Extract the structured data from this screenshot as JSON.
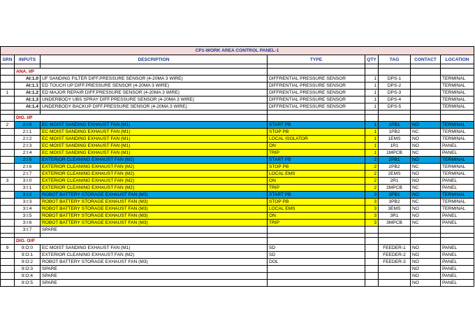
{
  "title": "CP1-WORK AREA CONTROL PANEL-1",
  "headers": [
    "SRN",
    "INPUTS",
    "DESCRIPTION",
    "TYPE",
    "QTY",
    "TAG",
    "CONTACT",
    "LOCATION"
  ],
  "sections": [
    {
      "label": "ANA. I/P",
      "srn": "1",
      "rows": [
        {
          "input": "AI:1.0",
          "desc": "UF SANDING  FILTER DIFF.PRESSURE SENSOR (4-20MA 3 WIRE)",
          "type": "DIFFRENTIAL PRESSURE SENSOR",
          "qty": "1",
          "tag": "DPS-1",
          "contact": "",
          "loc": "TERMINAL"
        },
        {
          "input": "AI:1.1",
          "desc": "ED TOUCH UP DIFF.PRESSURE SENSOR (4-20MA 3 WIRE)",
          "type": "DIFFRENTIAL PRESSURE SENSOR",
          "qty": "1",
          "tag": "DPS-2",
          "contact": "",
          "loc": "TERMINAL"
        },
        {
          "input": "AI:1.2",
          "desc": "ED MAJOR REPAIR DIFF.PRESSURE SENSOR (4-20MA 3 WIRE)",
          "type": "DIFFRENTIAL PRESSURE SENSOR",
          "qty": "1",
          "tag": "DPS-3",
          "contact": "",
          "loc": "TERMINAL"
        },
        {
          "input": "AI:1.3",
          "desc": "UNDERBODY UBS SPRAY DIFF.PRESSURE SENSOR (4-20MA 3 WIRE)",
          "type": "DIFFRENTIAL PRESSURE SENSOR",
          "qty": "1",
          "tag": "DPS-4",
          "contact": "",
          "loc": "TERMINAL"
        },
        {
          "input": "AI:1.4",
          "desc": "UNDERBODY BACKUP DIFF.PRESSURE SENSOR (4-20MA 3 WIRE)",
          "type": "DIFFRENTIAL PRESSURE SENSOR",
          "qty": "1",
          "tag": "DPS-5",
          "contact": "",
          "loc": "TERMINAL"
        }
      ]
    },
    {
      "label": "DIG. I/P",
      "rows": [
        {
          "srn": "2",
          "input": "2:I:0",
          "desc": "EC MOIST SANDING EXHAUST FAN   (M1)",
          "type": "START PB",
          "qty": "1",
          "tag": "1PB1",
          "contact": "NO",
          "loc": "TERMINAL",
          "style": "blue"
        },
        {
          "srn": "",
          "input": "2:I:1",
          "desc": "EC MOIST SANDING EXHAUST FAN   (M1)",
          "type": "STOP PB",
          "qty": "1",
          "tag": "1PB2",
          "contact": "NC",
          "loc": "TERMINAL",
          "style": "yellow"
        },
        {
          "srn": "",
          "input": "2:I:2",
          "desc": "EC MOIST SANDING EXHAUST FAN   (M1)",
          "type": "LOCAL ISOLATOR",
          "qty": "1",
          "tag": "1EMS",
          "contact": "NO",
          "loc": "TERMINAL",
          "style": "yellow"
        },
        {
          "srn": "",
          "input": "2:I:3",
          "desc": "EC MOIST SANDING EXHAUST FAN   (M1)",
          "type": "ON",
          "qty": "1",
          "tag": "1R1",
          "contact": "NO",
          "loc": "PANEL",
          "style": "yellow"
        },
        {
          "srn": "",
          "input": "2:I:4",
          "desc": "EC MOIST SANDING EXHAUST FAN   (M1)",
          "type": "TRIP",
          "qty": "1",
          "tag": "1MPCB",
          "contact": "NC",
          "loc": "PANEL",
          "style": "yellow"
        },
        {
          "srn": "",
          "input": "2:I:5",
          "desc": "EXTERIOR CLEANING EXHAUST FAN  (M2)",
          "type": "START PB",
          "qty": "2",
          "tag": "2PB1",
          "contact": "NO",
          "loc": "TERMINAL",
          "style": "blue"
        },
        {
          "srn": "",
          "input": "2:I:6",
          "desc": "EXTERIOR CLEANING EXHAUST FAN  (M2)",
          "type": "STOP PB",
          "qty": "2",
          "tag": "2PB2",
          "contact": "NC",
          "loc": "TERMINAL",
          "style": "yellow"
        },
        {
          "srn": "",
          "input": "2:I:7",
          "desc": "EXTERIOR CLEANING EXHAUST FAN  (M2)",
          "type": "LOCAL EMS",
          "qty": "2",
          "tag": "2EMS",
          "contact": "NO",
          "loc": "TERMINAL",
          "style": "yellow"
        },
        {
          "srn": "3",
          "input": "3:I:0",
          "desc": "EXTERIOR CLEANING EXHAUST FAN  (M2)",
          "type": "ON",
          "qty": "2",
          "tag": "2R1",
          "contact": "NO",
          "loc": "PANEL",
          "style": "yellow"
        },
        {
          "srn": "",
          "input": "3:I:1",
          "desc": "EXTERIOR CLEANING EXHAUST FAN  (M2)",
          "type": "TRIP",
          "qty": "2",
          "tag": "2MPCB",
          "contact": "NC",
          "loc": "PANEL",
          "style": "yellow"
        },
        {
          "srn": "",
          "input": "3:I:2",
          "desc": "ROBOT BATTERY STORAGE EXHAUST FAN    (M3)",
          "type": "START PB",
          "qty": "3",
          "tag": "3PB1",
          "contact": "NO",
          "loc": "TERMINAL",
          "style": "blue"
        },
        {
          "srn": "",
          "input": "3:I:3",
          "desc": "ROBOT BATTERY STORAGE EXHAUST FAN    (M3)",
          "type": "STOP PB",
          "qty": "3",
          "tag": "3PB2",
          "contact": "NC",
          "loc": "TERMINAL",
          "style": "yellow"
        },
        {
          "srn": "",
          "input": "3:I:4",
          "desc": "ROBOT BATTERY STORAGE EXHAUST FAN    (M3)",
          "type": "LOCAL EMS",
          "qty": "3",
          "tag": "3EMS",
          "contact": "NO",
          "loc": "TERMINAL",
          "style": "yellow"
        },
        {
          "srn": "",
          "input": "3:I:5",
          "desc": "ROBOT BATTERY STORAGE EXHAUST FAN    (M3)",
          "type": "ON",
          "qty": "3",
          "tag": "3R1",
          "contact": "NO",
          "loc": "PANEL",
          "style": "yellow"
        },
        {
          "srn": "",
          "input": "3:I:6",
          "desc": "ROBOT BATTERY STORAGE EXHAUST FAN    (M3)",
          "type": "TRIP",
          "qty": "3",
          "tag": "3MPCB",
          "contact": "NC",
          "loc": "PANEL",
          "style": "yellow"
        },
        {
          "srn": "",
          "input": "3:I:7",
          "desc": "SPARE",
          "type": "",
          "qty": "",
          "tag": "",
          "contact": "",
          "loc": "",
          "style": ""
        }
      ]
    },
    {
      "label": "DIG. O/P",
      "rows": [
        {
          "srn": "9",
          "input": "9:O:0",
          "desc": "EC MOIST SANDING EXHAUST FAN   (M1)",
          "type": "SD",
          "qty": "",
          "tag": "FEEDER-1",
          "contact": "NO",
          "loc": "PANEL",
          "style": ""
        },
        {
          "srn": "",
          "input": "9:O:1",
          "desc": "EXTERIOR CLEANING EXHAUST FAN  (M2)",
          "type": "SD",
          "qty": "",
          "tag": "FEEDER-2",
          "contact": "NO",
          "loc": "PANEL",
          "style": ""
        },
        {
          "srn": "",
          "input": "9:O:2",
          "desc": "ROBOT BATTERY STORAGE EXHAUST FAN    (M3)",
          "type": "DOL",
          "qty": "",
          "tag": "FEEDER-3",
          "contact": "NO",
          "loc": "PANEL",
          "style": ""
        },
        {
          "srn": "",
          "input": "9:O:3",
          "desc": "SPARE",
          "type": "",
          "qty": "",
          "tag": "",
          "contact": "NO",
          "loc": "PANEL",
          "style": ""
        },
        {
          "srn": "",
          "input": "9:O:4",
          "desc": "SPARE",
          "type": "",
          "qty": "",
          "tag": "",
          "contact": "NO",
          "loc": "PANEL",
          "style": ""
        },
        {
          "srn": "",
          "input": "9:O:5",
          "desc": "SPARE",
          "type": "",
          "qty": "",
          "tag": "",
          "contact": "NO",
          "loc": "PANEL",
          "style": ""
        }
      ]
    }
  ],
  "colors": {
    "blue_row": "#00a0e3",
    "yellow_cell": "#ffff00",
    "header_text": "#1f3a93",
    "section_text": "#c00000",
    "title_bg": "#f2dcdb"
  }
}
